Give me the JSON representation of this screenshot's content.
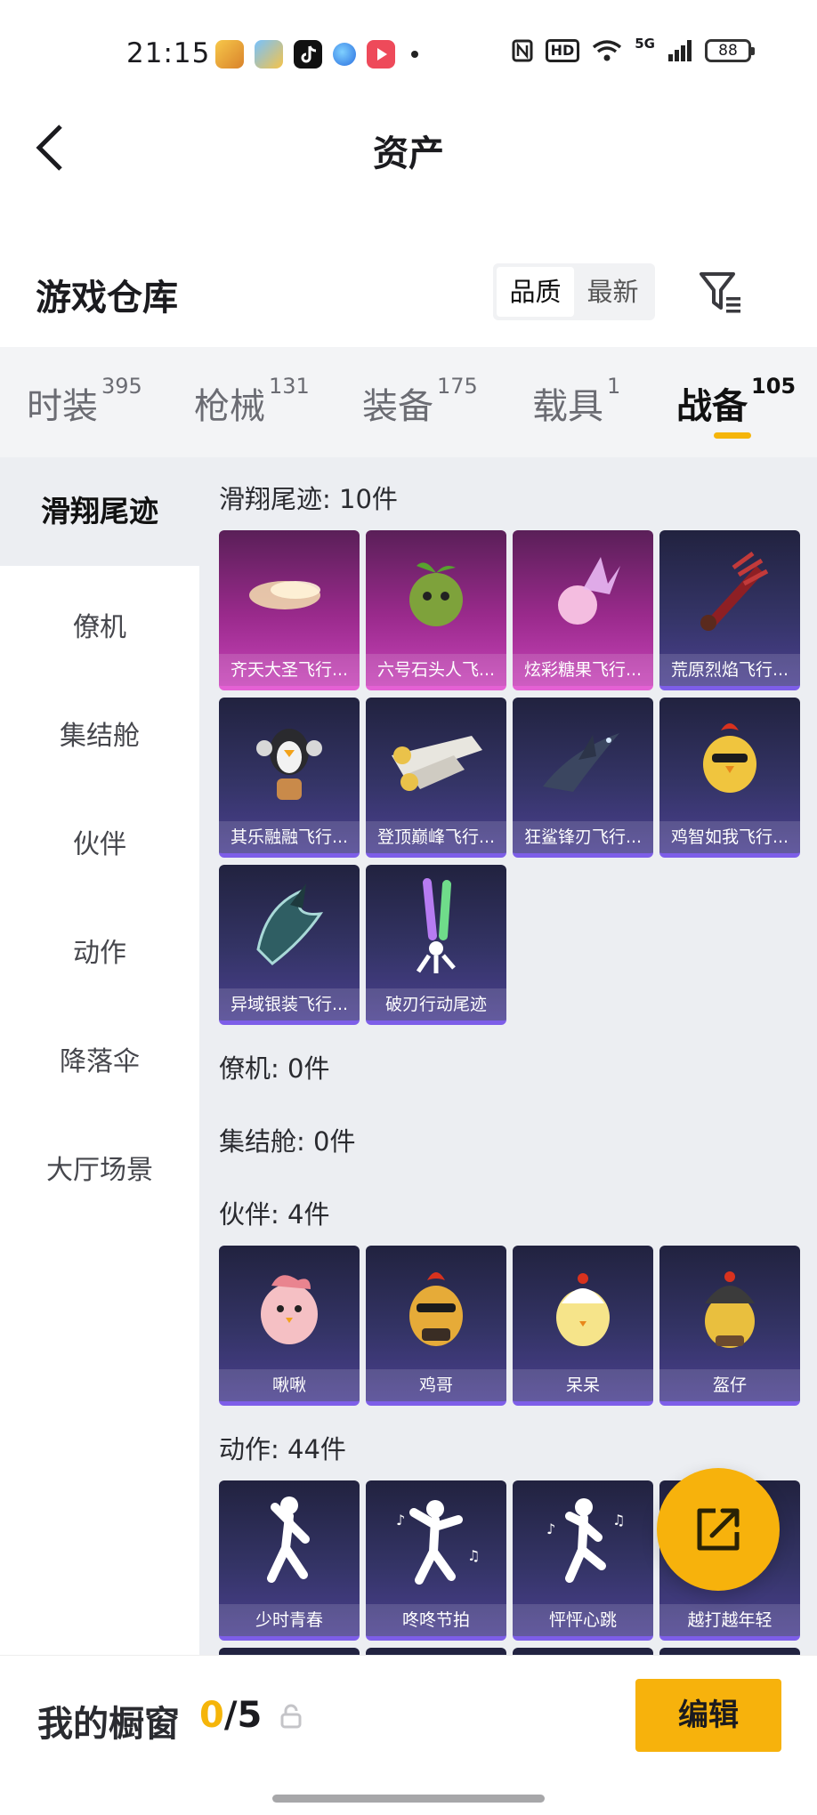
{
  "status_bar": {
    "time": "21:15",
    "battery": "88",
    "network": "5G",
    "hd": "HD"
  },
  "header": {
    "title": "资产"
  },
  "warehouse": {
    "title": "游戏仓库",
    "sort": [
      "品质",
      "最新"
    ]
  },
  "tabs": [
    {
      "label": "时装",
      "count": "395"
    },
    {
      "label": "枪械",
      "count": "131"
    },
    {
      "label": "装备",
      "count": "175"
    },
    {
      "label": "载具",
      "count": "1"
    },
    {
      "label": "战备",
      "count": "105"
    }
  ],
  "sidebar": [
    "滑翔尾迹",
    "僚机",
    "集结舱",
    "伙伴",
    "动作",
    "降落伞",
    "大厅场景"
  ],
  "sections": {
    "glide": {
      "title": "滑翔尾迹: 10件",
      "items": [
        "齐天大圣飞行...",
        "六号石头人飞...",
        "炫彩糖果飞行...",
        "荒原烈焰飞行...",
        "其乐融融飞行...",
        "登顶巅峰飞行...",
        "狂鲨锋刃飞行...",
        "鸡智如我飞行...",
        "异域银装飞行...",
        "破刃行动尾迹"
      ]
    },
    "wingman": {
      "title": "僚机: 0件"
    },
    "pod": {
      "title": "集结舱: 0件"
    },
    "partner": {
      "title": "伙伴: 4件",
      "items": [
        "啾啾",
        "鸡哥",
        "呆呆",
        "盔仔"
      ]
    },
    "emote": {
      "title": "动作: 44件",
      "items": [
        "少时青春",
        "咚咚节拍",
        "怦怦心跳",
        "越打越年轻"
      ]
    }
  },
  "bottom": {
    "label": "我的橱窗",
    "current": "0",
    "total": "/5",
    "edit": "编辑"
  }
}
